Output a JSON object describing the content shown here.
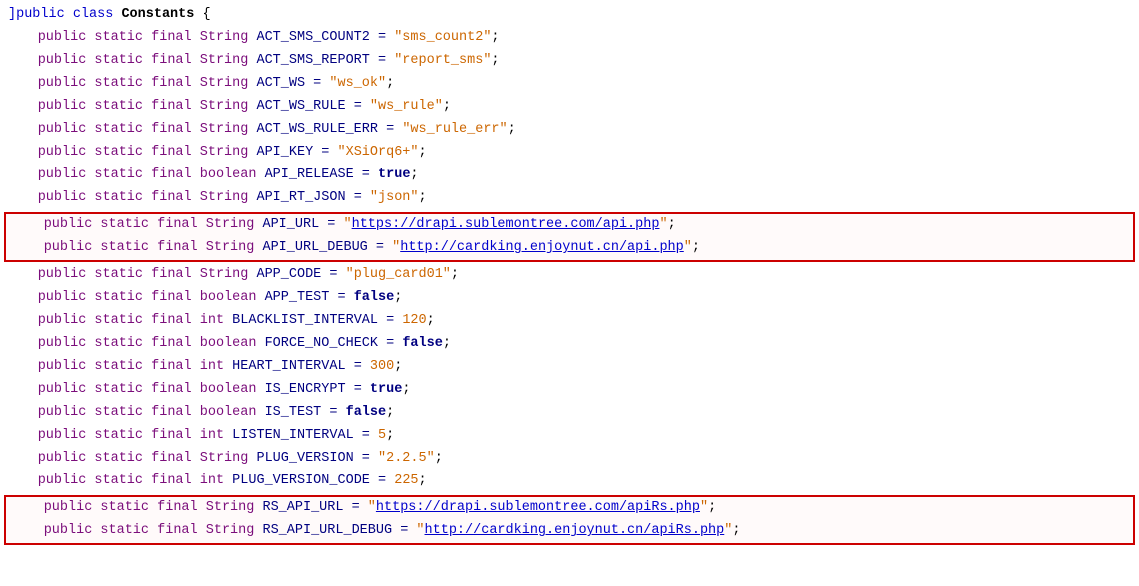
{
  "lines": [
    {
      "id": "line-class",
      "indent": 0,
      "parts": [
        {
          "t": "bracket",
          "v": "]"
        },
        {
          "t": "kw-public",
          "v": "public"
        },
        {
          "t": "plain",
          "v": " "
        },
        {
          "t": "kw-static",
          "v": "class"
        },
        {
          "t": "plain",
          "v": " "
        },
        {
          "t": "class-decl",
          "v": "Constants"
        },
        {
          "t": "plain",
          "v": " {"
        }
      ]
    },
    {
      "id": "line1",
      "indent": 1,
      "highlight": false,
      "parts": [
        {
          "t": "kw-public",
          "v": "public"
        },
        {
          "t": "plain",
          "v": " "
        },
        {
          "t": "kw-static",
          "v": "static"
        },
        {
          "t": "plain",
          "v": " "
        },
        {
          "t": "kw-final",
          "v": "final"
        },
        {
          "t": "plain",
          "v": " "
        },
        {
          "t": "kw-type",
          "v": "String"
        },
        {
          "t": "plain",
          "v": " ACT_SMS_COUNT2 = "
        },
        {
          "t": "str-val",
          "v": "\"sms_count2\""
        },
        {
          "t": "plain",
          "v": ";"
        }
      ]
    },
    {
      "id": "line2",
      "indent": 1,
      "parts": [
        {
          "t": "kw-public",
          "v": "public"
        },
        {
          "t": "plain",
          "v": " "
        },
        {
          "t": "kw-static",
          "v": "static"
        },
        {
          "t": "plain",
          "v": " "
        },
        {
          "t": "kw-final",
          "v": "final"
        },
        {
          "t": "plain",
          "v": " "
        },
        {
          "t": "kw-type",
          "v": "String"
        },
        {
          "t": "plain",
          "v": " ACT_SMS_REPORT = "
        },
        {
          "t": "str-val",
          "v": "\"report_sms\""
        },
        {
          "t": "plain",
          "v": ";"
        }
      ]
    },
    {
      "id": "line3",
      "indent": 1,
      "parts": [
        {
          "t": "kw-public",
          "v": "public"
        },
        {
          "t": "plain",
          "v": " "
        },
        {
          "t": "kw-static",
          "v": "static"
        },
        {
          "t": "plain",
          "v": " "
        },
        {
          "t": "kw-final",
          "v": "final"
        },
        {
          "t": "plain",
          "v": " "
        },
        {
          "t": "kw-type",
          "v": "String"
        },
        {
          "t": "plain",
          "v": " ACT_WS = "
        },
        {
          "t": "str-val",
          "v": "\"ws_ok\""
        },
        {
          "t": "plain",
          "v": ";"
        }
      ]
    },
    {
      "id": "line4",
      "indent": 1,
      "parts": [
        {
          "t": "kw-public",
          "v": "public"
        },
        {
          "t": "plain",
          "v": " "
        },
        {
          "t": "kw-static",
          "v": "static"
        },
        {
          "t": "plain",
          "v": " "
        },
        {
          "t": "kw-final",
          "v": "final"
        },
        {
          "t": "plain",
          "v": " "
        },
        {
          "t": "kw-type",
          "v": "String"
        },
        {
          "t": "plain",
          "v": " ACT_WS_RULE = "
        },
        {
          "t": "str-val",
          "v": "\"ws_rule\""
        },
        {
          "t": "plain",
          "v": ";"
        }
      ]
    },
    {
      "id": "line5",
      "indent": 1,
      "parts": [
        {
          "t": "kw-public",
          "v": "public"
        },
        {
          "t": "plain",
          "v": " "
        },
        {
          "t": "kw-static",
          "v": "static"
        },
        {
          "t": "plain",
          "v": " "
        },
        {
          "t": "kw-final",
          "v": "final"
        },
        {
          "t": "plain",
          "v": " "
        },
        {
          "t": "kw-type",
          "v": "String"
        },
        {
          "t": "plain",
          "v": " ACT_WS_RULE_ERR = "
        },
        {
          "t": "str-val",
          "v": "\"ws_rule_err\""
        },
        {
          "t": "plain",
          "v": ";"
        }
      ]
    },
    {
      "id": "line6",
      "indent": 1,
      "parts": [
        {
          "t": "kw-public",
          "v": "public"
        },
        {
          "t": "plain",
          "v": " "
        },
        {
          "t": "kw-static",
          "v": "static"
        },
        {
          "t": "plain",
          "v": " "
        },
        {
          "t": "kw-final",
          "v": "final"
        },
        {
          "t": "plain",
          "v": " "
        },
        {
          "t": "kw-type",
          "v": "String"
        },
        {
          "t": "plain",
          "v": " API_KEY = "
        },
        {
          "t": "str-val",
          "v": "\"XSiOrq6+\""
        },
        {
          "t": "plain",
          "v": ";"
        }
      ]
    },
    {
      "id": "line7",
      "indent": 1,
      "parts": [
        {
          "t": "kw-public",
          "v": "public"
        },
        {
          "t": "plain",
          "v": " "
        },
        {
          "t": "kw-static",
          "v": "static"
        },
        {
          "t": "plain",
          "v": " "
        },
        {
          "t": "kw-final",
          "v": "final"
        },
        {
          "t": "plain",
          "v": " "
        },
        {
          "t": "kw-type",
          "v": "boolean"
        },
        {
          "t": "plain",
          "v": " API_RELEASE = "
        },
        {
          "t": "bool-val",
          "v": "true"
        },
        {
          "t": "plain",
          "v": ";"
        }
      ]
    },
    {
      "id": "line8",
      "indent": 1,
      "parts": [
        {
          "t": "kw-public",
          "v": "public"
        },
        {
          "t": "plain",
          "v": " "
        },
        {
          "t": "kw-static",
          "v": "static"
        },
        {
          "t": "plain",
          "v": " "
        },
        {
          "t": "kw-final",
          "v": "final"
        },
        {
          "t": "plain",
          "v": " "
        },
        {
          "t": "kw-type",
          "v": "String"
        },
        {
          "t": "plain",
          "v": " API_RT_JSON = "
        },
        {
          "t": "str-val",
          "v": "\"json\""
        },
        {
          "t": "plain",
          "v": ";"
        }
      ]
    }
  ],
  "highlight_group1": [
    {
      "id": "hl1-line1",
      "parts": [
        {
          "t": "kw-public",
          "v": "public"
        },
        {
          "t": "plain",
          "v": " "
        },
        {
          "t": "kw-static",
          "v": "static"
        },
        {
          "t": "plain",
          "v": " "
        },
        {
          "t": "kw-final",
          "v": "final"
        },
        {
          "t": "plain",
          "v": " "
        },
        {
          "t": "kw-type",
          "v": "String"
        },
        {
          "t": "plain",
          "v": " API_URL = "
        },
        {
          "t": "str-start",
          "v": "\""
        },
        {
          "t": "link-val",
          "v": "https://drapi.sublemontree.com/api.php"
        },
        {
          "t": "str-end",
          "v": "\""
        },
        {
          "t": "plain",
          "v": ";"
        }
      ]
    },
    {
      "id": "hl1-line2",
      "parts": [
        {
          "t": "kw-public",
          "v": "public"
        },
        {
          "t": "plain",
          "v": " "
        },
        {
          "t": "kw-static",
          "v": "static"
        },
        {
          "t": "plain",
          "v": " "
        },
        {
          "t": "kw-final",
          "v": "final"
        },
        {
          "t": "plain",
          "v": " "
        },
        {
          "t": "kw-type",
          "v": "String"
        },
        {
          "t": "plain",
          "v": " API_URL_DEBUG = "
        },
        {
          "t": "str-start",
          "v": "\""
        },
        {
          "t": "link-val",
          "v": "http://cardking.enjoynut.cn/api.php"
        },
        {
          "t": "str-end",
          "v": "\""
        },
        {
          "t": "plain",
          "v": ";"
        }
      ]
    }
  ],
  "lines2": [
    {
      "id": "line9",
      "indent": 1,
      "parts": [
        {
          "t": "kw-public",
          "v": "public"
        },
        {
          "t": "plain",
          "v": " "
        },
        {
          "t": "kw-static",
          "v": "static"
        },
        {
          "t": "plain",
          "v": " "
        },
        {
          "t": "kw-final",
          "v": "final"
        },
        {
          "t": "plain",
          "v": " "
        },
        {
          "t": "kw-type",
          "v": "String"
        },
        {
          "t": "plain",
          "v": " APP_CODE = "
        },
        {
          "t": "str-val",
          "v": "\"plug_card01\""
        },
        {
          "t": "plain",
          "v": ";"
        }
      ]
    },
    {
      "id": "line10",
      "indent": 1,
      "parts": [
        {
          "t": "kw-public",
          "v": "public"
        },
        {
          "t": "plain",
          "v": " "
        },
        {
          "t": "kw-static",
          "v": "static"
        },
        {
          "t": "plain",
          "v": " "
        },
        {
          "t": "kw-final",
          "v": "final"
        },
        {
          "t": "plain",
          "v": " "
        },
        {
          "t": "kw-type",
          "v": "boolean"
        },
        {
          "t": "plain",
          "v": " APP_TEST = "
        },
        {
          "t": "bool-val",
          "v": "false"
        },
        {
          "t": "plain",
          "v": ";"
        }
      ]
    },
    {
      "id": "line11",
      "indent": 1,
      "parts": [
        {
          "t": "kw-public",
          "v": "public"
        },
        {
          "t": "plain",
          "v": " "
        },
        {
          "t": "kw-static",
          "v": "static"
        },
        {
          "t": "plain",
          "v": " "
        },
        {
          "t": "kw-final",
          "v": "final"
        },
        {
          "t": "plain",
          "v": " "
        },
        {
          "t": "kw-type",
          "v": "int"
        },
        {
          "t": "plain",
          "v": " BLACKLIST_INTERVAL = "
        },
        {
          "t": "num-val",
          "v": "120"
        },
        {
          "t": "plain",
          "v": ";"
        }
      ]
    },
    {
      "id": "line12",
      "indent": 1,
      "parts": [
        {
          "t": "kw-public",
          "v": "public"
        },
        {
          "t": "plain",
          "v": " "
        },
        {
          "t": "kw-static",
          "v": "static"
        },
        {
          "t": "plain",
          "v": " "
        },
        {
          "t": "kw-final",
          "v": "final"
        },
        {
          "t": "plain",
          "v": " "
        },
        {
          "t": "kw-type",
          "v": "boolean"
        },
        {
          "t": "plain",
          "v": " FORCE_NO_CHECK = "
        },
        {
          "t": "bool-val",
          "v": "false"
        },
        {
          "t": "plain",
          "v": ";"
        }
      ]
    },
    {
      "id": "line13",
      "indent": 1,
      "parts": [
        {
          "t": "kw-public",
          "v": "public"
        },
        {
          "t": "plain",
          "v": " "
        },
        {
          "t": "kw-static",
          "v": "static"
        },
        {
          "t": "plain",
          "v": " "
        },
        {
          "t": "kw-final",
          "v": "final"
        },
        {
          "t": "plain",
          "v": " "
        },
        {
          "t": "kw-type",
          "v": "int"
        },
        {
          "t": "plain",
          "v": " HEART_INTERVAL = "
        },
        {
          "t": "num-val",
          "v": "300"
        },
        {
          "t": "plain",
          "v": ";"
        }
      ]
    },
    {
      "id": "line14",
      "indent": 1,
      "parts": [
        {
          "t": "kw-public",
          "v": "public"
        },
        {
          "t": "plain",
          "v": " "
        },
        {
          "t": "kw-static",
          "v": "static"
        },
        {
          "t": "plain",
          "v": " "
        },
        {
          "t": "kw-final",
          "v": "final"
        },
        {
          "t": "plain",
          "v": " "
        },
        {
          "t": "kw-type",
          "v": "boolean"
        },
        {
          "t": "plain",
          "v": " IS_ENCRYPT = "
        },
        {
          "t": "bool-val",
          "v": "true"
        },
        {
          "t": "plain",
          "v": ";"
        }
      ]
    },
    {
      "id": "line15",
      "indent": 1,
      "parts": [
        {
          "t": "kw-public",
          "v": "public"
        },
        {
          "t": "plain",
          "v": " "
        },
        {
          "t": "kw-static",
          "v": "static"
        },
        {
          "t": "plain",
          "v": " "
        },
        {
          "t": "kw-final",
          "v": "final"
        },
        {
          "t": "plain",
          "v": " "
        },
        {
          "t": "kw-type",
          "v": "boolean"
        },
        {
          "t": "plain",
          "v": " IS_TEST = "
        },
        {
          "t": "bool-val",
          "v": "false"
        },
        {
          "t": "plain",
          "v": ";"
        }
      ]
    },
    {
      "id": "line16",
      "indent": 1,
      "parts": [
        {
          "t": "kw-public",
          "v": "public"
        },
        {
          "t": "plain",
          "v": " "
        },
        {
          "t": "kw-static",
          "v": "static"
        },
        {
          "t": "plain",
          "v": " "
        },
        {
          "t": "kw-final",
          "v": "final"
        },
        {
          "t": "plain",
          "v": " "
        },
        {
          "t": "kw-type",
          "v": "int"
        },
        {
          "t": "plain",
          "v": " LISTEN_INTERVAL = "
        },
        {
          "t": "num-val",
          "v": "5"
        },
        {
          "t": "plain",
          "v": ";"
        }
      ]
    },
    {
      "id": "line17",
      "indent": 1,
      "parts": [
        {
          "t": "kw-public",
          "v": "public"
        },
        {
          "t": "plain",
          "v": " "
        },
        {
          "t": "kw-static",
          "v": "static"
        },
        {
          "t": "plain",
          "v": " "
        },
        {
          "t": "kw-final",
          "v": "final"
        },
        {
          "t": "plain",
          "v": " "
        },
        {
          "t": "kw-type",
          "v": "String"
        },
        {
          "t": "plain",
          "v": " PLUG_VERSION = "
        },
        {
          "t": "str-val",
          "v": "\"2.2.5\""
        },
        {
          "t": "plain",
          "v": ";"
        }
      ]
    },
    {
      "id": "line18",
      "indent": 1,
      "parts": [
        {
          "t": "kw-public",
          "v": "public"
        },
        {
          "t": "plain",
          "v": " "
        },
        {
          "t": "kw-static",
          "v": "static"
        },
        {
          "t": "plain",
          "v": " "
        },
        {
          "t": "kw-final",
          "v": "final"
        },
        {
          "t": "plain",
          "v": " "
        },
        {
          "t": "kw-type",
          "v": "int"
        },
        {
          "t": "plain",
          "v": " PLUG_VERSION_CODE = "
        },
        {
          "t": "num-val",
          "v": "225"
        },
        {
          "t": "plain",
          "v": ";"
        }
      ]
    }
  ],
  "highlight_group2": [
    {
      "id": "hl2-line1",
      "parts": [
        {
          "t": "kw-public",
          "v": "public"
        },
        {
          "t": "plain",
          "v": " "
        },
        {
          "t": "kw-static",
          "v": "static"
        },
        {
          "t": "plain",
          "v": " "
        },
        {
          "t": "kw-final",
          "v": "final"
        },
        {
          "t": "plain",
          "v": " "
        },
        {
          "t": "kw-type",
          "v": "String"
        },
        {
          "t": "plain",
          "v": " RS_API_URL = "
        },
        {
          "t": "str-start",
          "v": "\""
        },
        {
          "t": "link-val",
          "v": "https://drapi.sublemontree.com/apiRs.php"
        },
        {
          "t": "str-end",
          "v": "\""
        },
        {
          "t": "plain",
          "v": ";"
        }
      ]
    },
    {
      "id": "hl2-line2",
      "parts": [
        {
          "t": "kw-public",
          "v": "public"
        },
        {
          "t": "plain",
          "v": " "
        },
        {
          "t": "kw-static",
          "v": "static"
        },
        {
          "t": "plain",
          "v": " "
        },
        {
          "t": "kw-final",
          "v": "final"
        },
        {
          "t": "plain",
          "v": " "
        },
        {
          "t": "kw-type",
          "v": "String"
        },
        {
          "t": "plain",
          "v": " RS_API_URL_DEBUG = "
        },
        {
          "t": "str-start",
          "v": "\""
        },
        {
          "t": "link-val",
          "v": "http://cardking.enjoynut.cn/apiRs.php"
        },
        {
          "t": "str-end",
          "v": "\""
        },
        {
          "t": "plain",
          "v": ";"
        }
      ]
    }
  ]
}
